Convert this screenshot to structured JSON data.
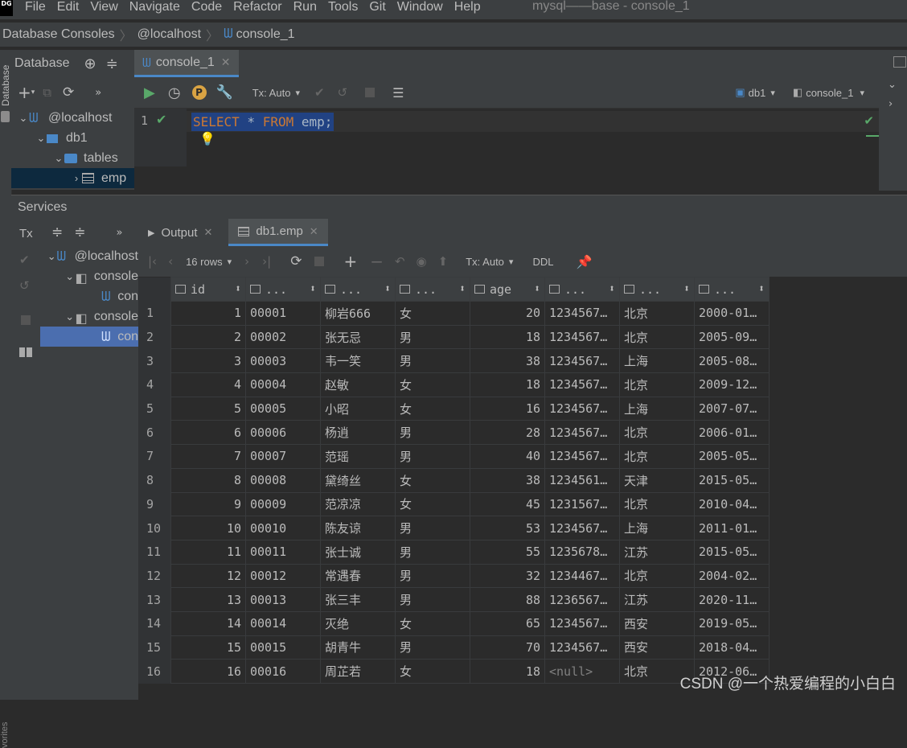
{
  "app": {
    "icon_text": "DG",
    "window_title": "mysql——base - console_1"
  },
  "menu": [
    "File",
    "Edit",
    "View",
    "Navigate",
    "Code",
    "Refactor",
    "Run",
    "Tools",
    "Git",
    "Window",
    "Help"
  ],
  "breadcrumb": [
    "Database Consoles",
    "@localhost",
    "console_1"
  ],
  "left_strip": {
    "top_label": "Database",
    "bottom_label": "vorites"
  },
  "db_panel": {
    "title": "Database",
    "tree": [
      {
        "label": "@localhost"
      },
      {
        "label": "db1"
      },
      {
        "label": "tables"
      },
      {
        "label": "emp"
      }
    ]
  },
  "editor": {
    "tab_label": "console_1",
    "tx_label": "Tx: Auto",
    "db_selector": "db1",
    "console_selector": "console_1",
    "line_number": "1",
    "sql": {
      "k1": "SELECT",
      "star": " * ",
      "k2": "FROM",
      "rest": " emp;"
    }
  },
  "services": {
    "title": "Services",
    "tx_label": "Tx",
    "tree": [
      {
        "label": "@localhost"
      },
      {
        "label": "console"
      },
      {
        "label": "con"
      },
      {
        "label": "console"
      },
      {
        "label": "con"
      }
    ]
  },
  "results": {
    "tabs": [
      "Output",
      "db1.emp"
    ],
    "rows_label": "16 rows",
    "tx_label": "Tx: Auto",
    "ddl_label": "DDL",
    "columns": [
      "id",
      "...",
      "...",
      "...",
      "age",
      "...",
      "...",
      "..."
    ],
    "rows": [
      [
        "1",
        "1",
        "00001",
        "柳岩666",
        "女",
        "20",
        "1234567…",
        "北京",
        "2000-01…"
      ],
      [
        "2",
        "2",
        "00002",
        "张无忌",
        "男",
        "18",
        "1234567…",
        "北京",
        "2005-09…"
      ],
      [
        "3",
        "3",
        "00003",
        "韦一笑",
        "男",
        "38",
        "1234567…",
        "上海",
        "2005-08…"
      ],
      [
        "4",
        "4",
        "00004",
        "赵敏",
        "女",
        "18",
        "1234567…",
        "北京",
        "2009-12…"
      ],
      [
        "5",
        "5",
        "00005",
        "小昭",
        "女",
        "16",
        "1234567…",
        "上海",
        "2007-07…"
      ],
      [
        "6",
        "6",
        "00006",
        "杨逍",
        "男",
        "28",
        "1234567…",
        "北京",
        "2006-01…"
      ],
      [
        "7",
        "7",
        "00007",
        "范瑶",
        "男",
        "40",
        "1234567…",
        "北京",
        "2005-05…"
      ],
      [
        "8",
        "8",
        "00008",
        "黛绮丝",
        "女",
        "38",
        "1234561…",
        "天津",
        "2015-05…"
      ],
      [
        "9",
        "9",
        "00009",
        "范凉凉",
        "女",
        "45",
        "1231567…",
        "北京",
        "2010-04…"
      ],
      [
        "10",
        "10",
        "00010",
        "陈友谅",
        "男",
        "53",
        "1234567…",
        "上海",
        "2011-01…"
      ],
      [
        "11",
        "11",
        "00011",
        "张士诚",
        "男",
        "55",
        "1235678…",
        "江苏",
        "2015-05…"
      ],
      [
        "12",
        "12",
        "00012",
        "常遇春",
        "男",
        "32",
        "1234467…",
        "北京",
        "2004-02…"
      ],
      [
        "13",
        "13",
        "00013",
        "张三丰",
        "男",
        "88",
        "1236567…",
        "江苏",
        "2020-11…"
      ],
      [
        "14",
        "14",
        "00014",
        "灭绝",
        "女",
        "65",
        "1234567…",
        "西安",
        "2019-05…"
      ],
      [
        "15",
        "15",
        "00015",
        "胡青牛",
        "男",
        "70",
        "1234567…",
        "西安",
        "2018-04…"
      ],
      [
        "16",
        "16",
        "00016",
        "周芷若",
        "女",
        "18",
        "<null>",
        "北京",
        "2012-06…"
      ]
    ]
  },
  "watermark": "CSDN @一个热爱编程的小白白",
  "colors": {
    "accent": "#4a88c7",
    "run_green": "#59a869",
    "selection": "#214283",
    "keyword": "#cc7832"
  }
}
